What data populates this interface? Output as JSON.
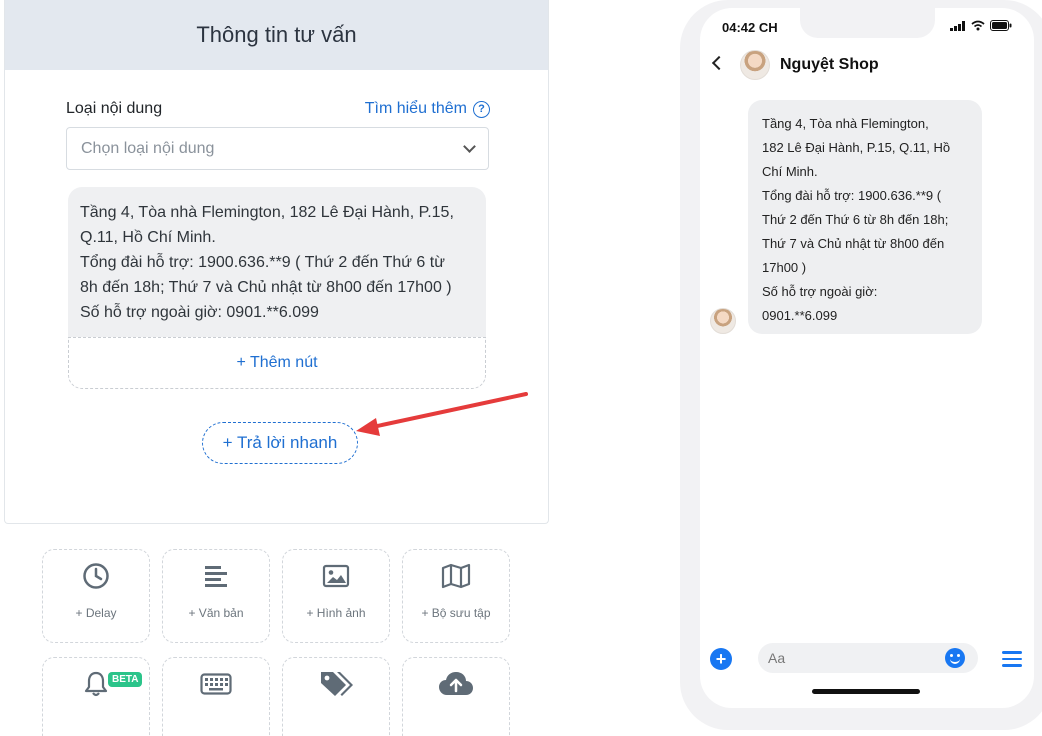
{
  "panel": {
    "title": "Thông tin tư vấn",
    "content_type_label": "Loại nội dung",
    "learn_more": "Tìm hiểu thêm",
    "select_placeholder": "Chọn loại nội dung",
    "message_lines": [
      "Tầng 4, Tòa nhà Flemington, 182 Lê Đại Hành, P.15,",
      "Q.11, Hồ Chí Minh.",
      "Tổng đài hỗ trợ: 1900.636.**9 ( Thứ 2 đến Thứ 6 từ",
      "8h đến 18h; Thứ 7 và Chủ nhật từ 8h00 đến 17h00 )",
      "Số hỗ trợ ngoài giờ: 0901.**6.099"
    ],
    "add_button_label": "+ Thêm nút",
    "quick_reply_label": "+ Trả lời nhanh"
  },
  "tools": [
    {
      "label": "+ Delay",
      "icon": "clock-icon"
    },
    {
      "label": "+ Văn bản",
      "icon": "text-align-icon"
    },
    {
      "label": "+ Hình ảnh",
      "icon": "image-icon"
    },
    {
      "label": "+ Bộ sưu tập",
      "icon": "map-icon"
    },
    {
      "label": "",
      "icon": "bell-icon",
      "badge": "BETA"
    },
    {
      "label": "",
      "icon": "keyboard-icon"
    },
    {
      "label": "",
      "icon": "tags-icon"
    },
    {
      "label": "",
      "icon": "cloud-upload-icon"
    }
  ],
  "phone": {
    "time": "04:42 CH",
    "shop_name": "Nguyệt Shop",
    "bubble_lines": [
      "Tầng 4, Tòa nhà Flemington,",
      "182 Lê Đại Hành, P.15, Q.11, Hồ",
      "Chí Minh.",
      "Tổng đài hỗ trợ: 1900.636.**9 (",
      "Thứ 2 đến Thứ 6 từ 8h đến 18h;",
      "Thứ 7 và Chủ nhật từ 8h00 đến",
      "17h00 )",
      "Số hỗ trợ ngoài giờ:",
      "0901.**6.099"
    ],
    "input_placeholder": "Aa"
  },
  "colors": {
    "accent": "#1f6fd1",
    "messenger_blue": "#1877f2",
    "arrow_red": "#e53b3b",
    "beta_green": "#2bc48a"
  }
}
